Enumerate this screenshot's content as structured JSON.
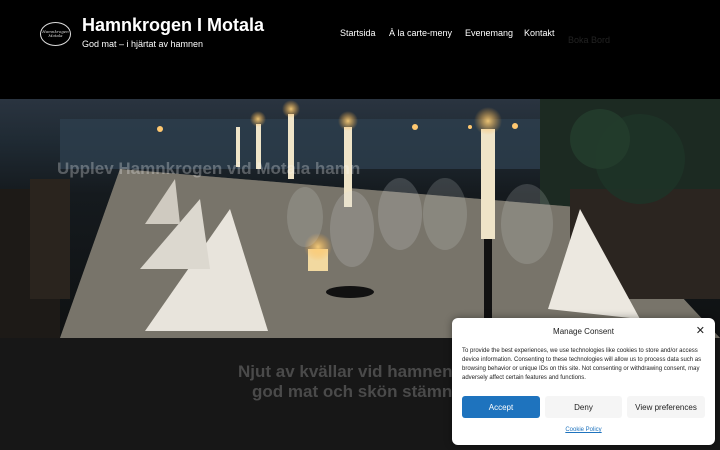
{
  "header": {
    "logo_text": "Hamnkrogen Motala",
    "site_title": "Hamnkrogen I Motala",
    "tagline": "God mat – i hjärtat av hamnen"
  },
  "nav": {
    "items": [
      "Startsida",
      "À la carte-meny",
      "Evenemang",
      "Kontakt",
      "Boka Bord"
    ]
  },
  "hero": {
    "heading": "Upplev Hamnkrogen vid Motala hamn"
  },
  "section": {
    "line1": "Njut av kvällar vid hamnen med",
    "line2": "god mat och skön stämning"
  },
  "consent": {
    "title": "Manage Consent",
    "body": "To provide the best experiences, we use technologies like cookies to store and/or access device information. Consenting to these technologies will allow us to process data such as browsing behavior or unique IDs on this site. Not consenting or withdrawing consent, may adversely affect certain features and functions.",
    "accept": "Accept",
    "deny": "Deny",
    "preferences": "View preferences",
    "policy_link": "Cookie Policy",
    "accent_color": "#1e73be"
  }
}
